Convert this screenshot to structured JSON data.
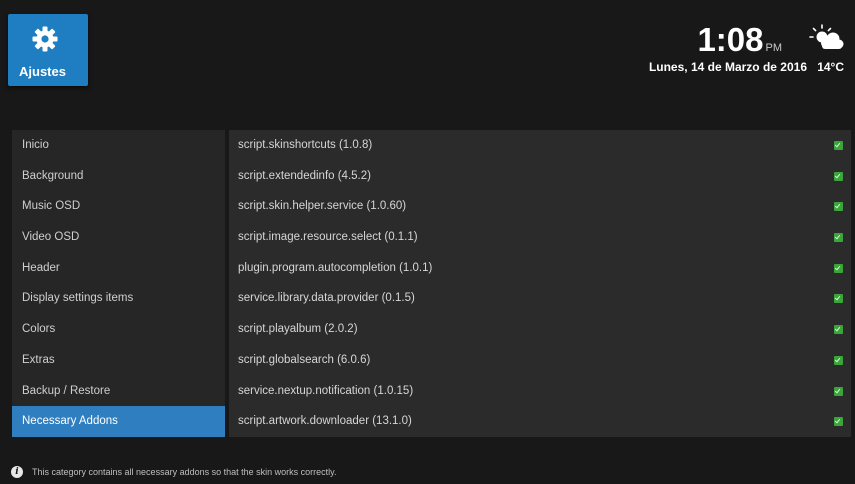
{
  "header": {
    "tile_label": "Ajustes",
    "tile_icon": "gear-icon",
    "time": "1:08",
    "ampm": "PM",
    "date": "Lunes, 14 de Marzo de 2016",
    "temperature": "14°C",
    "weather_icon": "partly-cloudy-icon"
  },
  "sidebar": {
    "items": [
      {
        "label": "Inicio"
      },
      {
        "label": "Background"
      },
      {
        "label": "Music OSD"
      },
      {
        "label": "Video OSD"
      },
      {
        "label": "Header"
      },
      {
        "label": "Display settings items"
      },
      {
        "label": "Colors"
      },
      {
        "label": "Extras"
      },
      {
        "label": "Backup / Restore"
      },
      {
        "label": "Necessary Addons"
      }
    ],
    "selected_index": 9,
    "selected_color": "#2f7fc0"
  },
  "addons": [
    {
      "name": "script.skinshortcuts (1.0.8)",
      "installed": true
    },
    {
      "name": "script.extendedinfo (4.5.2)",
      "installed": true
    },
    {
      "name": "script.skin.helper.service (1.0.60)",
      "installed": true
    },
    {
      "name": "script.image.resource.select (0.1.1)",
      "installed": true
    },
    {
      "name": "plugin.program.autocompletion (1.0.1)",
      "installed": true
    },
    {
      "name": "service.library.data.provider (0.1.5)",
      "installed": true
    },
    {
      "name": "script.playalbum (2.0.2)",
      "installed": true
    },
    {
      "name": "script.globalsearch (6.0.6)",
      "installed": true
    },
    {
      "name": "service.nextup.notification (1.0.15)",
      "installed": true
    },
    {
      "name": "script.artwork.downloader (13.1.0)",
      "installed": true
    }
  ],
  "footer": {
    "info_icon": "info-icon",
    "text": "This category contains all necessary addons so that the skin works correctly."
  },
  "colors": {
    "accent": "#1f7ec2",
    "check": "#3aa63a"
  }
}
